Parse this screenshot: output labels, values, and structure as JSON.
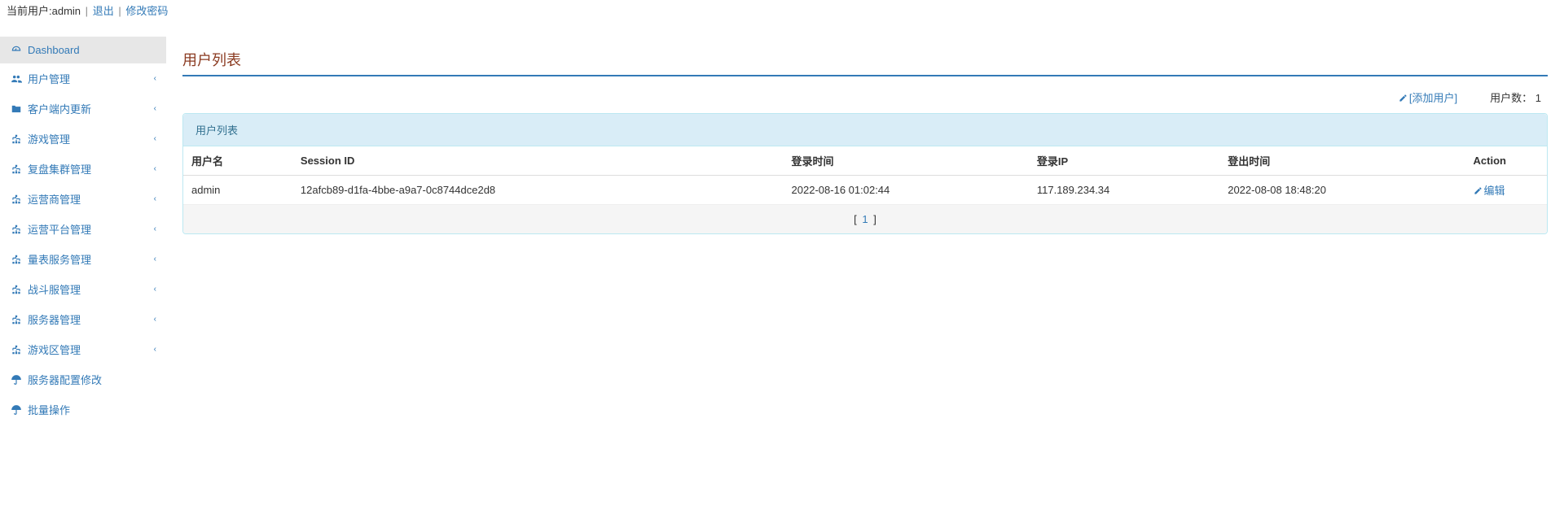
{
  "header": {
    "current_user_label": "当前用户:",
    "current_user_value": "admin",
    "logout": "退出",
    "change_password": "修改密码"
  },
  "sidebar": {
    "items": [
      {
        "icon": "dashboard-icon",
        "label": "Dashboard",
        "expandable": false,
        "active": true
      },
      {
        "icon": "users-icon",
        "label": "用户管理",
        "expandable": true
      },
      {
        "icon": "folder-icon",
        "label": "客户端内更新",
        "expandable": true
      },
      {
        "icon": "sitemap-icon",
        "label": "游戏管理",
        "expandable": true
      },
      {
        "icon": "sitemap-icon",
        "label": "复盘集群管理",
        "expandable": true
      },
      {
        "icon": "sitemap-icon",
        "label": "运营商管理",
        "expandable": true
      },
      {
        "icon": "sitemap-icon",
        "label": "运营平台管理",
        "expandable": true
      },
      {
        "icon": "sitemap-icon",
        "label": "量表服务管理",
        "expandable": true
      },
      {
        "icon": "sitemap-icon",
        "label": "战斗服管理",
        "expandable": true
      },
      {
        "icon": "sitemap-icon",
        "label": "服务器管理",
        "expandable": true
      },
      {
        "icon": "sitemap-icon",
        "label": "游戏区管理",
        "expandable": true
      },
      {
        "icon": "umbrella-icon",
        "label": "服务器配置修改",
        "expandable": false
      },
      {
        "icon": "umbrella-icon",
        "label": "批量操作",
        "expandable": false
      }
    ]
  },
  "page": {
    "title": "用户列表",
    "add_user_label": "[添加用户]",
    "user_count_label": "用户数：",
    "user_count_value": "1",
    "panel_title": "用户列表"
  },
  "table": {
    "headers": {
      "username": "用户名",
      "session_id": "Session ID",
      "login_time": "登录时间",
      "login_ip": "登录IP",
      "logout_time": "登出时间",
      "action": "Action"
    },
    "rows": [
      {
        "username": "admin",
        "session_id": "12afcb89-d1fa-4bbe-a9a7-0c8744dce2d8",
        "login_time": "2022-08-16 01:02:44",
        "login_ip": "117.189.234.34",
        "logout_time": "2022-08-08 18:48:20",
        "edit_label": "编辑"
      }
    ]
  },
  "pagination": {
    "current": "1"
  }
}
